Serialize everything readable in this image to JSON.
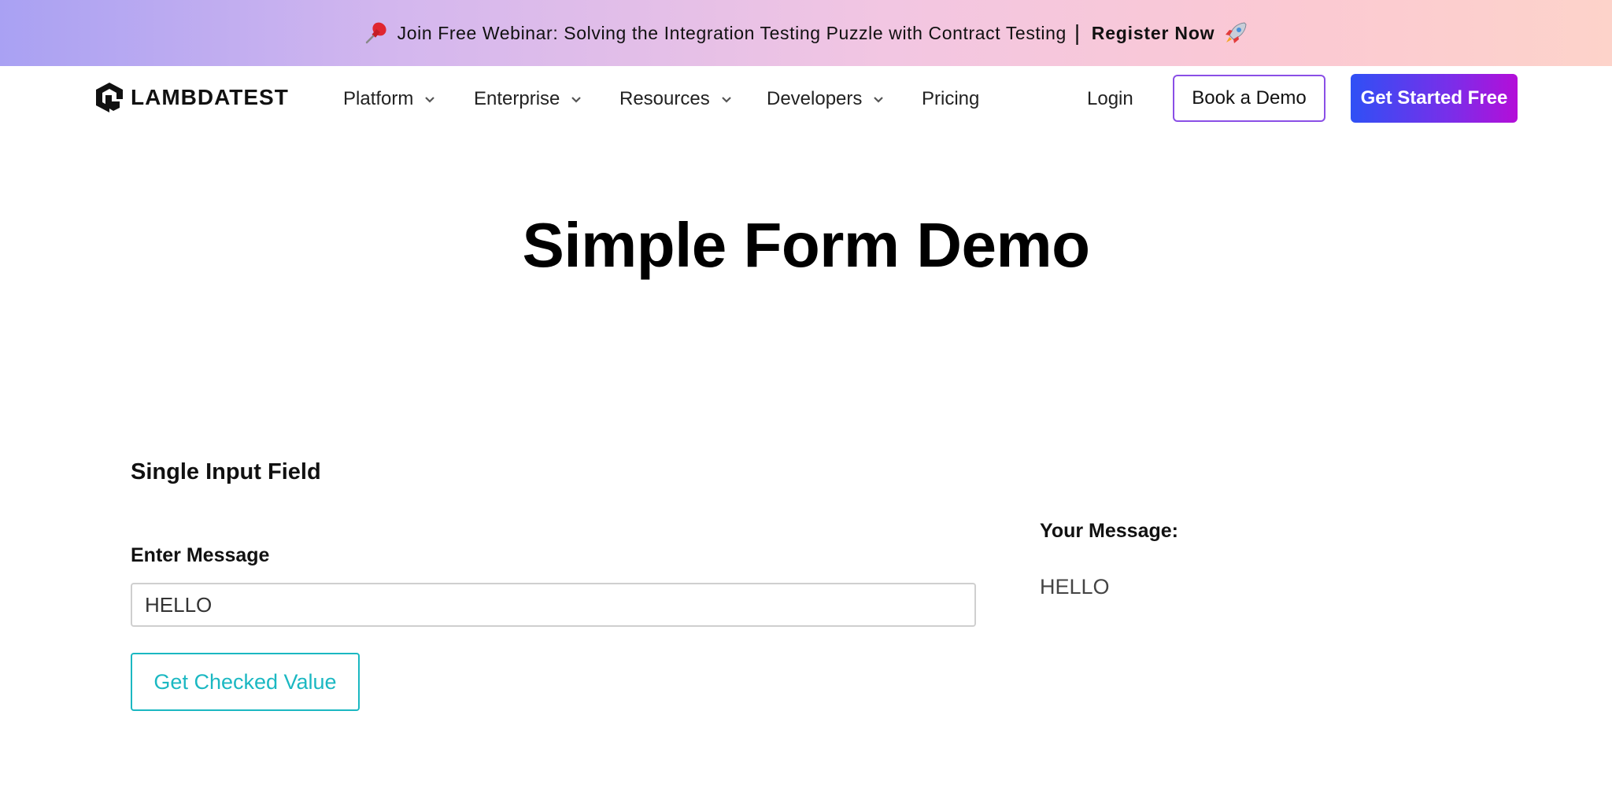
{
  "banner": {
    "pin_icon": "pushpin-icon",
    "text": "Join Free Webinar: Solving the Integration Testing Puzzle with Contract Testing",
    "separator": "|",
    "register_label": "Register Now",
    "rocket_icon": "rocket-icon"
  },
  "nav": {
    "logo_text": "LAMBDATEST",
    "items": [
      {
        "label": "Platform",
        "has_dropdown": true
      },
      {
        "label": "Enterprise",
        "has_dropdown": true
      },
      {
        "label": "Resources",
        "has_dropdown": true
      },
      {
        "label": "Developers",
        "has_dropdown": true
      },
      {
        "label": "Pricing",
        "has_dropdown": false
      }
    ],
    "login_label": "Login",
    "demo_label": "Book a Demo",
    "start_label": "Get Started Free"
  },
  "page": {
    "title": "Simple Form Demo"
  },
  "form": {
    "section_title": "Single Input Field",
    "field_label": "Enter Message",
    "input_value": "HELLO",
    "button_label": "Get Checked Value",
    "output_label": "Your Message:",
    "output_value": "HELLO"
  },
  "colors": {
    "accent_teal": "#1bb8c2",
    "cta_gradient_start": "#2f50f5",
    "cta_gradient_end": "#b40ed8"
  }
}
